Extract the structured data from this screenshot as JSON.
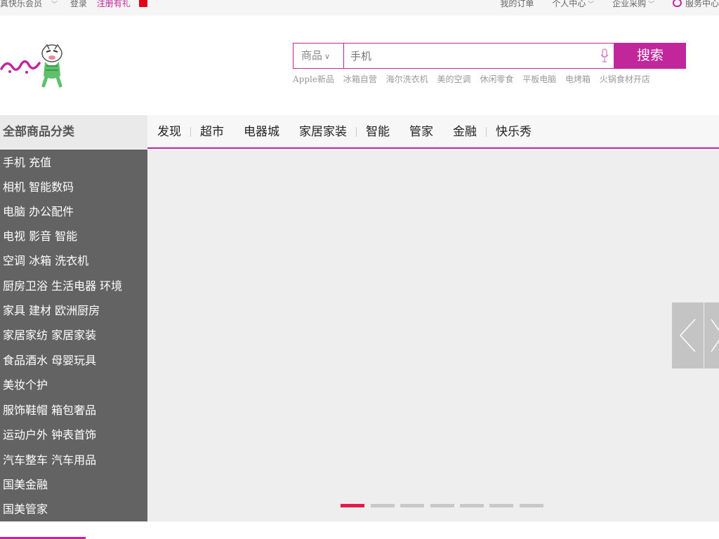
{
  "topbar": {
    "member": "真快乐会员",
    "login": "登录",
    "register": "注册有礼",
    "my_orders": "我的订单",
    "personal_center": "个人中心",
    "enterprise": "企业采购",
    "service_center": "服务中心"
  },
  "search": {
    "category": "商品",
    "placeholder": "手机",
    "button": "搜索",
    "hotwords": [
      "Apple新品",
      "冰箱自营",
      "海尔洗衣机",
      "美的空调",
      "休闲零食",
      "平板电脑",
      "电烤箱",
      "火锅食材开店"
    ]
  },
  "nav": {
    "all_categories": "全部商品分类",
    "items": [
      "发现",
      "超市",
      "电器城",
      "家居家装",
      "智能",
      "管家",
      "金融",
      "快乐秀"
    ]
  },
  "sidebar": {
    "items": [
      "手机 充值",
      "相机 智能数码",
      "电脑 办公配件",
      "电视 影音 智能",
      "空调 冰箱 洗衣机",
      "厨房卫浴 生活电器 环境",
      "家具 建材 欧洲厨房",
      "家居家纺 家居家装",
      "食品酒水 母婴玩具",
      "美妆个护",
      "服饰鞋帽 箱包奢品",
      "运动户外 钟表首饰",
      "汽车整车 汽车用品",
      "国美金融",
      "国美管家"
    ]
  },
  "carousel": {
    "slide_count": 7,
    "active_index": 0
  },
  "colors": {
    "brand": "#c1269b",
    "active_dot": "#e3194d",
    "sidebar_bg": "#636363"
  }
}
